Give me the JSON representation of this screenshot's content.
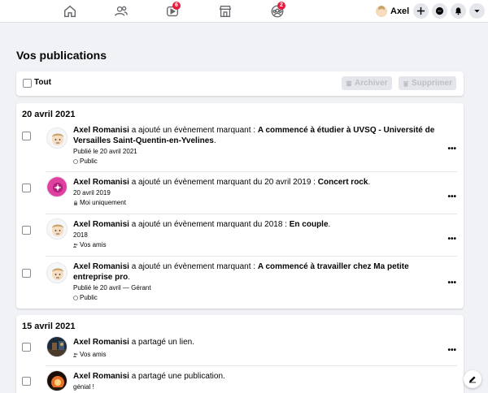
{
  "nav": {
    "icons": [
      "home-icon",
      "friends-icon",
      "watch-icon",
      "marketplace-icon",
      "groups-icon"
    ],
    "badges": {
      "watch": "6",
      "groups": "2"
    },
    "profile_name": "Axel",
    "right_buttons": [
      "plus-icon",
      "messenger-icon",
      "notifications-icon",
      "account-menu-icon"
    ]
  },
  "page": {
    "title": "Vos publications"
  },
  "toolbar": {
    "select_all_label": "Tout",
    "archive_label": "Archiver",
    "delete_label": "Supprimer"
  },
  "sections": [
    {
      "date": "20 avril 2021",
      "items": [
        {
          "author": "Axel Romanisi",
          "action": " a ajouté un évènement marquant : ",
          "object": "A commencé à étudier à UVSQ - Université de Versailles Saint-Quentin-en-Yvelines",
          "suffix": ".",
          "sub": "Publié le 20 avril 2021",
          "privacy": "Public",
          "privacy_icon": "globe-icon"
        },
        {
          "author": "Axel Romanisi",
          "action": " a ajouté un évènement marquant du 20 avril 2019 : ",
          "object": "Concert rock",
          "suffix": ".",
          "sub": "20 avril 2019",
          "privacy": "Moi uniquement",
          "privacy_icon": "lock-icon"
        },
        {
          "author": "Axel Romanisi",
          "action": " a ajouté un évènement marquant du 2018 : ",
          "object": "En couple",
          "suffix": ".",
          "sub": "2018",
          "privacy": "Vos amis",
          "privacy_icon": "friends-icon"
        },
        {
          "author": "Axel Romanisi",
          "action": " a ajouté un évènement marquant : ",
          "object": "A commencé à travailler chez Ma petite entreprise pro",
          "suffix": ".",
          "sub": "Publié le 20 avril — Gérant",
          "privacy": "Public",
          "privacy_icon": "globe-icon"
        }
      ]
    },
    {
      "date": "15 avril 2021",
      "items": [
        {
          "author": "Axel Romanisi",
          "action": " a partagé un lien.",
          "object": "",
          "suffix": "",
          "sub": "",
          "privacy": "Vos amis",
          "privacy_icon": "friends-icon"
        },
        {
          "author": "Axel Romanisi",
          "action": " a partagé une publication.",
          "object": "",
          "suffix": "",
          "sub": "génial !",
          "privacy": "",
          "privacy_icon": ""
        }
      ]
    }
  ],
  "more_label": "•••",
  "colors": {
    "badge": "#e41e3f",
    "background": "#f0f2f5",
    "button_disabled": "#e4e6eb"
  }
}
